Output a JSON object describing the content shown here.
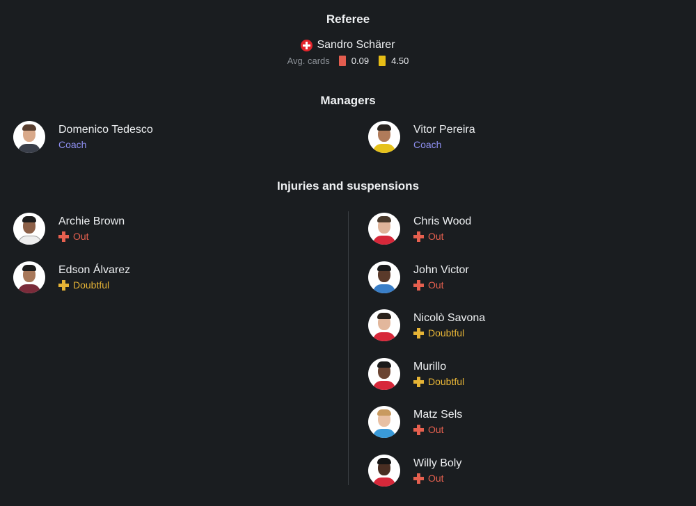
{
  "referee": {
    "title": "Referee",
    "name": "Sandro Schärer",
    "flag": "switzerland-flag",
    "avg_cards_label": "Avg. cards",
    "red_avg": "0.09",
    "yellow_avg": "4.50"
  },
  "managers": {
    "title": "Managers",
    "home": {
      "name": "Domenico Tedesco",
      "role": "Coach"
    },
    "away": {
      "name": "Vitor Pereira",
      "role": "Coach"
    }
  },
  "injuries": {
    "title": "Injuries and suspensions",
    "home": [
      {
        "name": "Archie Brown",
        "status": "Out"
      },
      {
        "name": "Edson Álvarez",
        "status": "Doubtful"
      }
    ],
    "away": [
      {
        "name": "Chris Wood",
        "status": "Out"
      },
      {
        "name": "John Victor",
        "status": "Out"
      },
      {
        "name": "Nicolò Savona",
        "status": "Doubtful"
      },
      {
        "name": "Murillo",
        "status": "Doubtful"
      },
      {
        "name": "Matz Sels",
        "status": "Out"
      },
      {
        "name": "Willy Boly",
        "status": "Out"
      }
    ]
  },
  "colors": {
    "background": "#1a1d20",
    "coach": "#8e8ff0",
    "out": "#e6604f",
    "doubtful": "#e6b436",
    "red_card": "#e35d4f",
    "yellow_card": "#e6bd16"
  }
}
